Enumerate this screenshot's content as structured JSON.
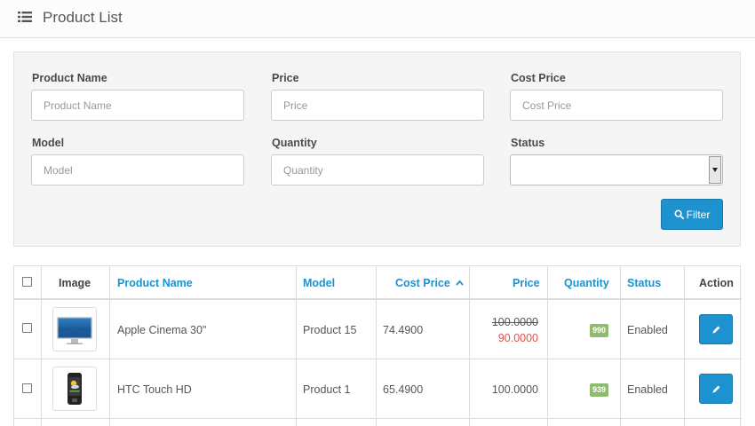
{
  "heading": {
    "title": "Product List",
    "icon": "list-icon"
  },
  "filter": {
    "product_name": {
      "label": "Product Name",
      "placeholder": "Product Name"
    },
    "price": {
      "label": "Price",
      "placeholder": "Price"
    },
    "cost_price": {
      "label": "Cost Price",
      "placeholder": "Cost Price"
    },
    "model": {
      "label": "Model",
      "placeholder": "Model"
    },
    "quantity": {
      "label": "Quantity",
      "placeholder": "Quantity"
    },
    "status": {
      "label": "Status",
      "value": ""
    },
    "button_label": "Filter"
  },
  "table": {
    "columns": {
      "image": "Image",
      "product_name": "Product Name",
      "model": "Model",
      "cost_price": "Cost Price",
      "price": "Price",
      "quantity": "Quantity",
      "status": "Status",
      "action": "Action"
    },
    "rows": [
      {
        "name": "Apple Cinema 30\"",
        "model": "Product 15",
        "cost_price": "74.4900",
        "price": "100.0000",
        "special": "90.0000",
        "quantity": "990",
        "status": "Enabled",
        "image": "monitor"
      },
      {
        "name": "HTC Touch HD",
        "model": "Product 1",
        "cost_price": "65.4900",
        "price": "100.0000",
        "special": "",
        "quantity": "939",
        "status": "Enabled",
        "image": "phone"
      }
    ]
  },
  "colors": {
    "primary": "#1e91cf",
    "badge": "#8fbb6c",
    "special": "#e05050"
  }
}
